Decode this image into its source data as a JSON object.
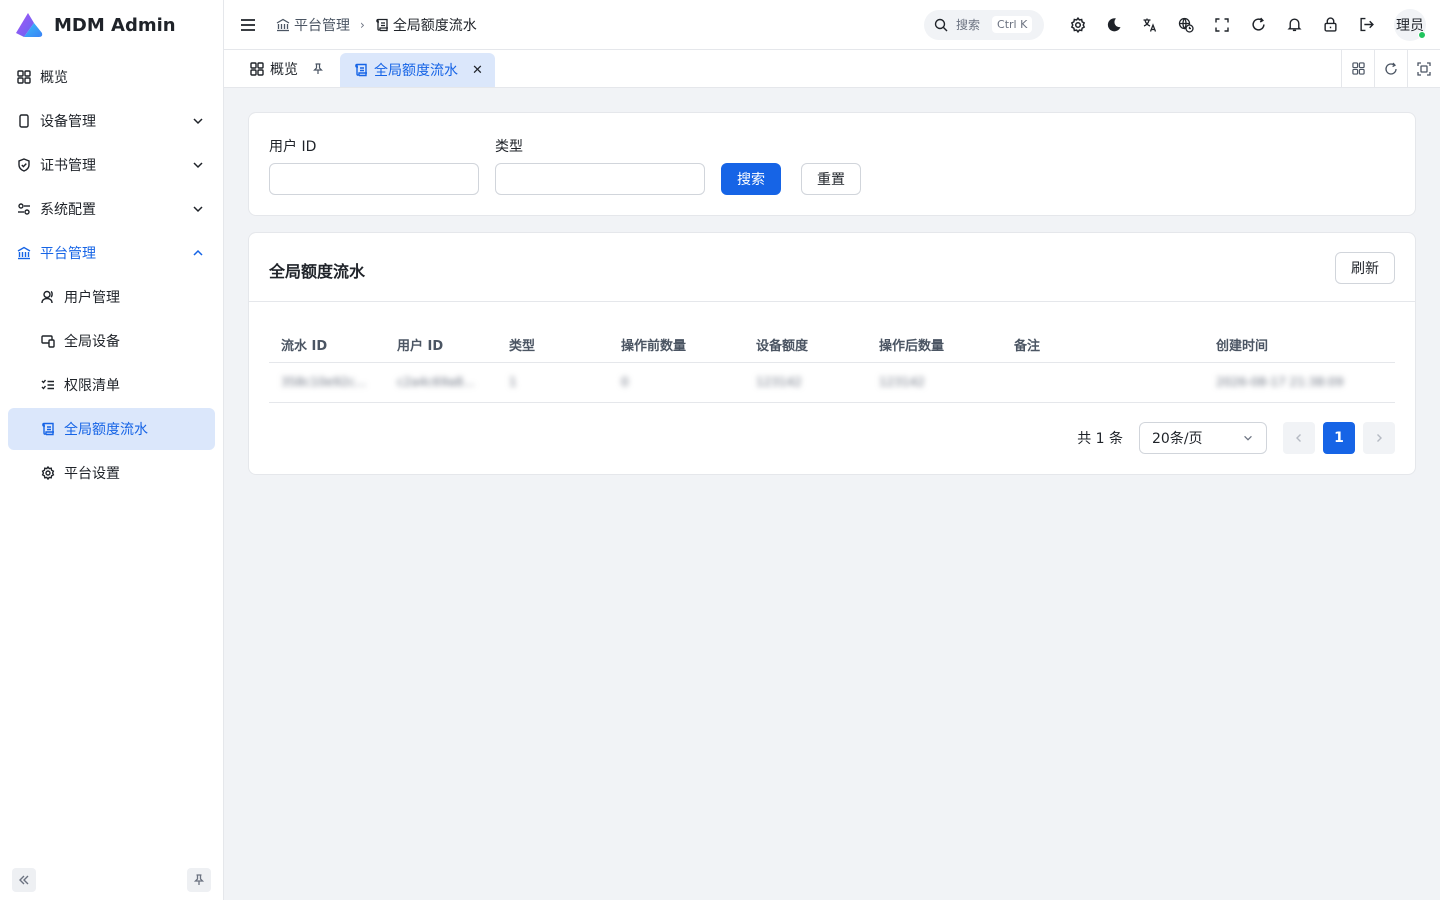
{
  "app": {
    "title": "MDM Admin"
  },
  "sidebar": {
    "items": [
      {
        "label": "概览"
      },
      {
        "label": "设备管理"
      },
      {
        "label": "证书管理"
      },
      {
        "label": "系统配置"
      },
      {
        "label": "平台管理"
      }
    ],
    "sub_items": [
      {
        "label": "用户管理"
      },
      {
        "label": "全局设备"
      },
      {
        "label": "权限清单"
      },
      {
        "label": "全局额度流水"
      },
      {
        "label": "平台设置"
      }
    ]
  },
  "header": {
    "breadcrumb": [
      "平台管理",
      "全局额度流水"
    ],
    "search": {
      "label": "搜索",
      "shortcut": "Ctrl K"
    },
    "avatar_text": "理员"
  },
  "tabs": [
    {
      "label": "概览"
    },
    {
      "label": "全局额度流水"
    }
  ],
  "filter": {
    "user_id_label": "用户 ID",
    "type_label": "类型",
    "user_id_value": "",
    "type_value": "",
    "search_button": "搜索",
    "reset_button": "重置"
  },
  "table": {
    "title": "全局额度流水",
    "refresh_button": "刷新",
    "columns": [
      "流水 ID",
      "用户 ID",
      "类型",
      "操作前数量",
      "设备额度",
      "操作后数量",
      "备注",
      "创建时间"
    ],
    "rows": [
      [
        "358c10e92c...",
        "c2a4c69a8...",
        "1",
        "0",
        "123142",
        "123142",
        "",
        "2026-08-17 21:38:09"
      ]
    ]
  },
  "pagination": {
    "total_label": "共 1 条",
    "page_size": "20条/页",
    "current_page": "1"
  },
  "colors": {
    "accent": "#1664e6",
    "accent_bg": "#dbe7fb",
    "online": "#22c55e"
  }
}
